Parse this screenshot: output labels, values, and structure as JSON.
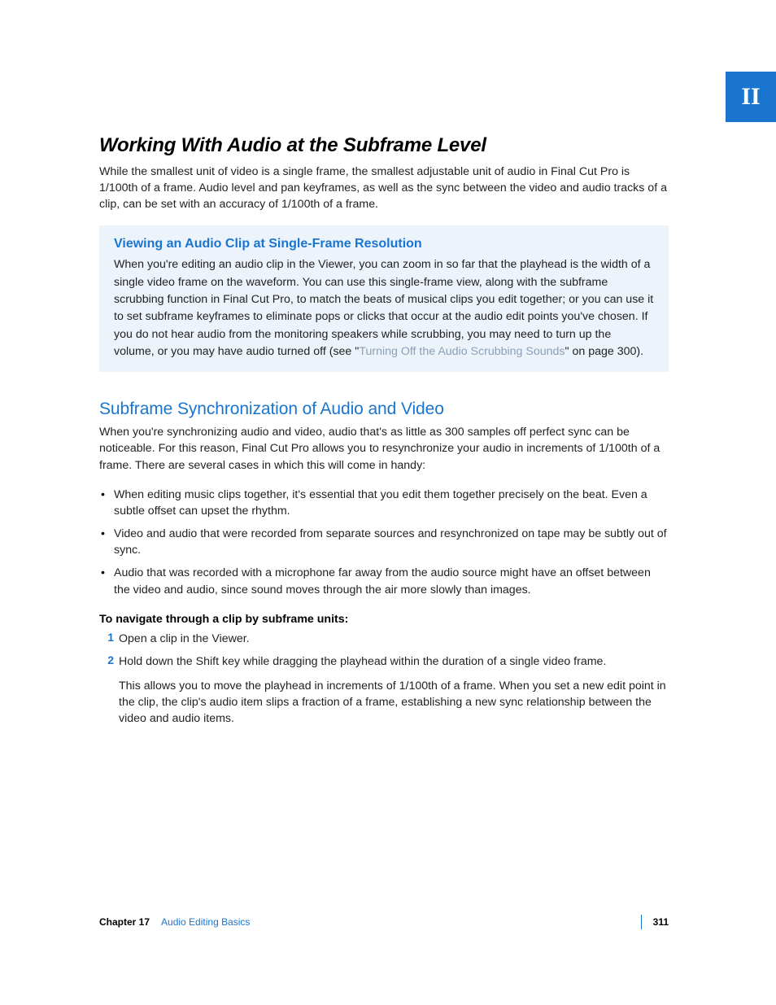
{
  "part_tab": "II",
  "title": "Working With Audio at the Subframe Level",
  "intro": "While the smallest unit of video is a single frame, the smallest adjustable unit of audio in Final Cut Pro is 1/100th of a frame. Audio level and pan keyframes, as well as the sync between the video and audio tracks of a clip, can be set with an accuracy of 1/100th of a frame.",
  "box": {
    "heading": "Viewing an Audio Clip at Single-Frame Resolution",
    "text_before_link": "When you're editing an audio clip in the Viewer, you can zoom in so far that the playhead is the width of a single video frame on the waveform. You can use this single-frame view, along with the subframe scrubbing function in Final Cut Pro, to match the beats of musical clips you edit together; or you can use it to set subframe keyframes to eliminate pops or clicks that occur at the audio edit points you've chosen. If you do not hear audio from the monitoring speakers while scrubbing, you may need to turn up the volume, or you may have audio turned off (see \"",
    "link_text": "Turning Off the Audio Scrubbing Sounds",
    "text_after_link": "\" on page 300)."
  },
  "subsection": {
    "heading": "Subframe Synchronization of Audio and Video",
    "intro": "When you're synchronizing audio and video, audio that's as little as 300 samples off perfect sync can be noticeable. For this reason, Final Cut Pro allows you to resynchronize your audio in increments of 1/100th of a frame. There are several cases in which this will come in handy:",
    "bullets": [
      "When editing music clips together, it's essential that you edit them together precisely on the beat. Even a subtle offset can upset the rhythm.",
      "Video and audio that were recorded from separate sources and resynchronized on tape may be subtly out of sync.",
      "Audio that was recorded with a microphone far away from the audio source might have an offset between the video and audio, since sound moves through the air more slowly than images."
    ],
    "steps_heading": "To navigate through a clip by subframe units:",
    "steps": [
      "Open a clip in the Viewer.",
      "Hold down the Shift key while dragging the playhead within the duration of a single video frame."
    ],
    "step_follow": "This allows you to move the playhead in increments of 1/100th of a frame. When you set a new edit point in the clip, the clip's audio item slips a fraction of a frame, establishing a new sync relationship between the video and audio items."
  },
  "footer": {
    "chapter_label": "Chapter 17",
    "chapter_title": "Audio Editing Basics",
    "page_number": "311"
  }
}
